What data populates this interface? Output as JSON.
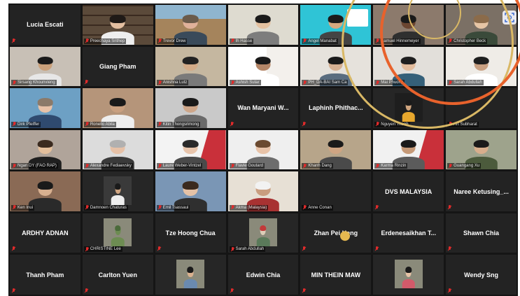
{
  "colors": {
    "accent_red": "#e02b2b",
    "speaker_frame": "#ffd23a",
    "ring_gold": "#d9b865",
    "ring_orange": "#e8622c"
  },
  "tiles": [
    {
      "name": "Lucia Escati",
      "mode": "name"
    },
    {
      "name": "Preechaya Srithep",
      "mode": "video",
      "bg": "#5b4a3a",
      "skin": "#e3bfa1",
      "hair": "#1f1a17",
      "shirt": "#eeeeee",
      "scene": "bookshelf"
    },
    {
      "name": "Trevor Drew",
      "mode": "video",
      "bg": "#a5845c",
      "skin": "#e0b19a",
      "hair": "#6b5b4b",
      "shirt": "#3a4a5a",
      "scene": "landscape"
    },
    {
      "name": "Ih Hasse",
      "mode": "video",
      "bg": "#dedbd0",
      "skin": "#e4c1a0",
      "hair": "#1a1a1a",
      "shirt": "#7d7d7d",
      "speaker": true
    },
    {
      "name": "Angel Manabat",
      "mode": "video",
      "bg": "#2fc4d6",
      "skin": "#d7a97f",
      "hair": "#1b1b1b",
      "shirt": "#444444",
      "scene": "swine"
    },
    {
      "name": "Samuel Hinnemeyer",
      "mode": "video",
      "bg": "#8c7a6c",
      "skin": "#6b4530",
      "hair": "#1a1a1a",
      "shirt": "#2f2f2f"
    },
    {
      "name": "Christopher Beck",
      "mode": "video",
      "bg": "#7b7065",
      "skin": "#e6c5a5",
      "hair": "#8b6b4a",
      "shirt": "#3a4a3a",
      "focus": true
    },
    {
      "name": "Sirsang Khounvieng",
      "mode": "video",
      "bg": "#c8c0b6",
      "skin": "#caa07a",
      "hair": "#1a1a1a",
      "shirt": "#e7e7e7"
    },
    {
      "name": "Giang Pham",
      "mode": "name"
    },
    {
      "name": "Anishna Lutz",
      "mode": "video",
      "bg": "#c5b7a0",
      "skin": "#d3ab88",
      "hair": "#222222",
      "shirt": "#7a7a7a"
    },
    {
      "name": "Ashish Sutar",
      "mode": "video",
      "bg": "#f3f0ec",
      "skin": "#b58768",
      "hair": "#1a1a1a",
      "shirt": "#ffffff",
      "scene": "gfta"
    },
    {
      "name": "PH_DA-BAI Sam Ca",
      "mode": "video",
      "bg": "#e6e2dc",
      "skin": "#d5b092",
      "hair": "#1a1a1a",
      "shirt": "#5a6d7f"
    },
    {
      "name": "Mai Phuong",
      "mode": "video",
      "bg": "#e2dfda",
      "skin": "#e2bc9d",
      "hair": "#1f1f1f",
      "shirt": "#356079"
    },
    {
      "name": "Sarah Abdullah",
      "mode": "video",
      "bg": "#efece7",
      "skin": "#c9a082",
      "hair": "#1f1f1f",
      "shirt": "#ffffff"
    },
    {
      "name": "Dirk Pfeiffer",
      "mode": "video",
      "bg": "#6da0c4",
      "skin": "#e8c2a8",
      "hair": "#8b7a6a",
      "shirt": "#2f4a6f"
    },
    {
      "name": "Ronello Abila",
      "mode": "video",
      "bg": "#b5957a",
      "skin": "#c9a080",
      "hair": "#1a1a1a",
      "shirt": "#eeeeee"
    },
    {
      "name": "Kitin Thongsrimong",
      "mode": "video",
      "bg": "#c9c9c9",
      "skin": "#cea689",
      "hair": "#1a1a1a",
      "shirt": "#6a6a6a"
    },
    {
      "name": "Wan Maryani W...",
      "mode": "name"
    },
    {
      "name": "Laphinh Phithac...",
      "mode": "name"
    },
    {
      "name": "Nguyen Thanh",
      "mode": "video",
      "bg": "#1e1e1e",
      "skin": "#d0a57f",
      "hair": "#1a1a1a",
      "shirt": "#e7a72d",
      "small": true
    },
    {
      "name": "Art Subharat",
      "mode": "name",
      "blank": true
    },
    {
      "name": "Ngan DY (FAO RAP)",
      "mode": "video",
      "bg": "#b0a49a",
      "skin": "#e3bf9c",
      "hair": "#3a2a1f",
      "shirt": "#1f1f1f"
    },
    {
      "name": "Alexandre Fediaevsky",
      "mode": "video",
      "bg": "#dcdcdc",
      "skin": "#e6c1a7",
      "hair": "#b0b0b0",
      "shirt": "#3a3a3a"
    },
    {
      "name": "Laure Weber-Vintzel",
      "mode": "video",
      "bg": "#f3f3f3",
      "skin": "#e8c5ac",
      "hair": "#2a2a2a",
      "shirt": "#4a4a4a",
      "scene": "oie"
    },
    {
      "name": "Flavie Goutard",
      "mode": "video",
      "bg": "#efefef",
      "skin": "#e8c3a8",
      "hair": "#6b4a30",
      "shirt": "#6d6d6d"
    },
    {
      "name": "Khanh Dang",
      "mode": "video",
      "bg": "#b7a58a",
      "skin": "#cfa583",
      "hair": "#1a1a1a",
      "shirt": "#4a4a4a"
    },
    {
      "name": "Karma Rinzin",
      "mode": "video",
      "bg": "#f1f1f1",
      "skin": "#c69a78",
      "hair": "#1a1a1a",
      "shirt": "#5b5b5b",
      "scene": "oie"
    },
    {
      "name": "Guangang Xu",
      "mode": "video",
      "bg": "#9ea38c",
      "skin": "#d8ae8c",
      "hair": "#1a1a1a",
      "shirt": "#4c5b3c"
    },
    {
      "name": "Ken Inui",
      "mode": "video",
      "bg": "#8a6a55",
      "skin": "#d8b090",
      "hair": "#1a1a1a",
      "shirt": "#2a2a2a"
    },
    {
      "name": "Damnoen Chaturas",
      "mode": "video",
      "bg": "#3a3a3a",
      "skin": "#d1a682",
      "hair": "#1a1a1a",
      "shirt": "#eeeeee",
      "small": true
    },
    {
      "name": "Emil Tsassaui",
      "mode": "video",
      "bg": "#7a96b5",
      "skin": "#e5c2a6",
      "hair": "#3a2a1f",
      "shirt": "#2f2f2f"
    },
    {
      "name": "Akma (Malaysia)",
      "mode": "video",
      "bg": "#e7e0d5",
      "skin": "#c99d7f",
      "hair": "#f2f2f2",
      "shirt": "#a83232"
    },
    {
      "name": "Anne Conan",
      "mode": "name",
      "blank": true
    },
    {
      "name": "DVS MALAYSIA",
      "mode": "name"
    },
    {
      "name": "Naree Ketusing_...",
      "mode": "name"
    },
    {
      "name": "ARDHY ADNAN",
      "mode": "name"
    },
    {
      "name": "CHRISTINE Lee",
      "mode": "video",
      "bg": "#2a2a2a",
      "skin": "#6d8c52",
      "hair": "#4a6a3a",
      "shirt": "#6d8c52",
      "small": true
    },
    {
      "name": "Tze Hoong Chua",
      "mode": "name"
    },
    {
      "name": "Sarah Abdullah",
      "mode": "video",
      "bg": "#2a2a2a",
      "skin": "#dccdb8",
      "hair": "#c23a3a",
      "shirt": "#5a7a5a",
      "small": true
    },
    {
      "name": "Zhan Pei Heng",
      "mode": "name",
      "dot": true
    },
    {
      "name": "Erdenesaikhan T...",
      "mode": "name"
    },
    {
      "name": "Shawn Chia",
      "mode": "name"
    },
    {
      "name": "Thanh Pham",
      "mode": "name"
    },
    {
      "name": "Carlton Yuen",
      "mode": "name"
    },
    {
      "name": "",
      "mode": "video",
      "bg": "#2a2a2a",
      "skin": "#d9b18f",
      "hair": "#1a1a1a",
      "shirt": "#6a8ab0",
      "small": true,
      "nolabel": true
    },
    {
      "name": "Edwin Chia",
      "mode": "name"
    },
    {
      "name": "MIN THEIN MAW",
      "mode": "name"
    },
    {
      "name": "",
      "mode": "video",
      "bg": "#2a2a2a",
      "skin": "#e6c3a6",
      "hair": "#1a1a1a",
      "shirt": "#d35a6a",
      "small": true,
      "nolabel": true
    },
    {
      "name": "Wendy Sng",
      "mode": "name"
    }
  ]
}
